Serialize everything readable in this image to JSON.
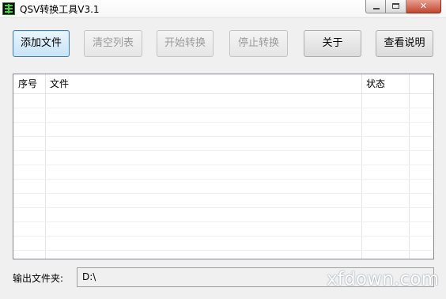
{
  "window": {
    "title": "QSV转换工具V3.1",
    "app_icon": "terminal-grid-icon",
    "controls": {
      "minimize": "minimize-icon",
      "maximize": "maximize-icon",
      "close": "✕"
    }
  },
  "toolbar": {
    "add_file": "添加文件",
    "clear_list": "清空列表",
    "start_convert": "开始转换",
    "stop_convert": "停止转换",
    "about": "关于",
    "view_help": "查看说明"
  },
  "list": {
    "columns": [
      "序号",
      "文件",
      "状态"
    ],
    "rows": []
  },
  "output": {
    "label": "输出文件夹:",
    "value": "D:\\"
  },
  "watermark": "xfdown.com"
}
